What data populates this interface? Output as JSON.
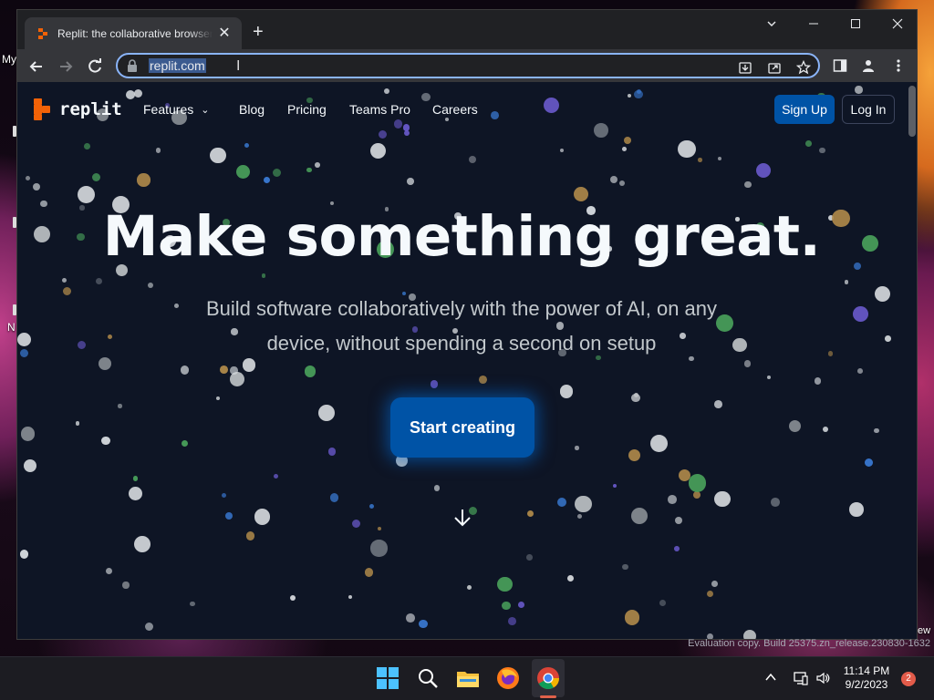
{
  "desktop": {
    "label_left_top": "My",
    "label_left_mid": "N",
    "label_right": "ew"
  },
  "browser": {
    "tab_title": "Replit: the collaborative browser",
    "tab_close": "✕",
    "new_tab": "+",
    "url": "replit.com"
  },
  "page": {
    "logo_text": "replit",
    "nav": {
      "features": "Features",
      "blog": "Blog",
      "pricing": "Pricing",
      "teams_pro": "Teams Pro",
      "careers": "Careers",
      "sign_up": "Sign Up",
      "log_in": "Log In"
    },
    "hero_title": "Make something great.",
    "hero_sub_line1": "Build software collaboratively with the power of AI, on any",
    "hero_sub_line2": "device, without spending a second on setup",
    "cta": "Start creating"
  },
  "watermark": "Evaluation copy. Build 25375.zn_release.230830-1632",
  "taskbar": {
    "time": "11:14 PM",
    "date": "9/2/2023",
    "notifications": "2"
  },
  "colors": {
    "page_bg": "#0e1525",
    "brand_orange": "#f26207",
    "primary_blue": "#0053a6"
  }
}
